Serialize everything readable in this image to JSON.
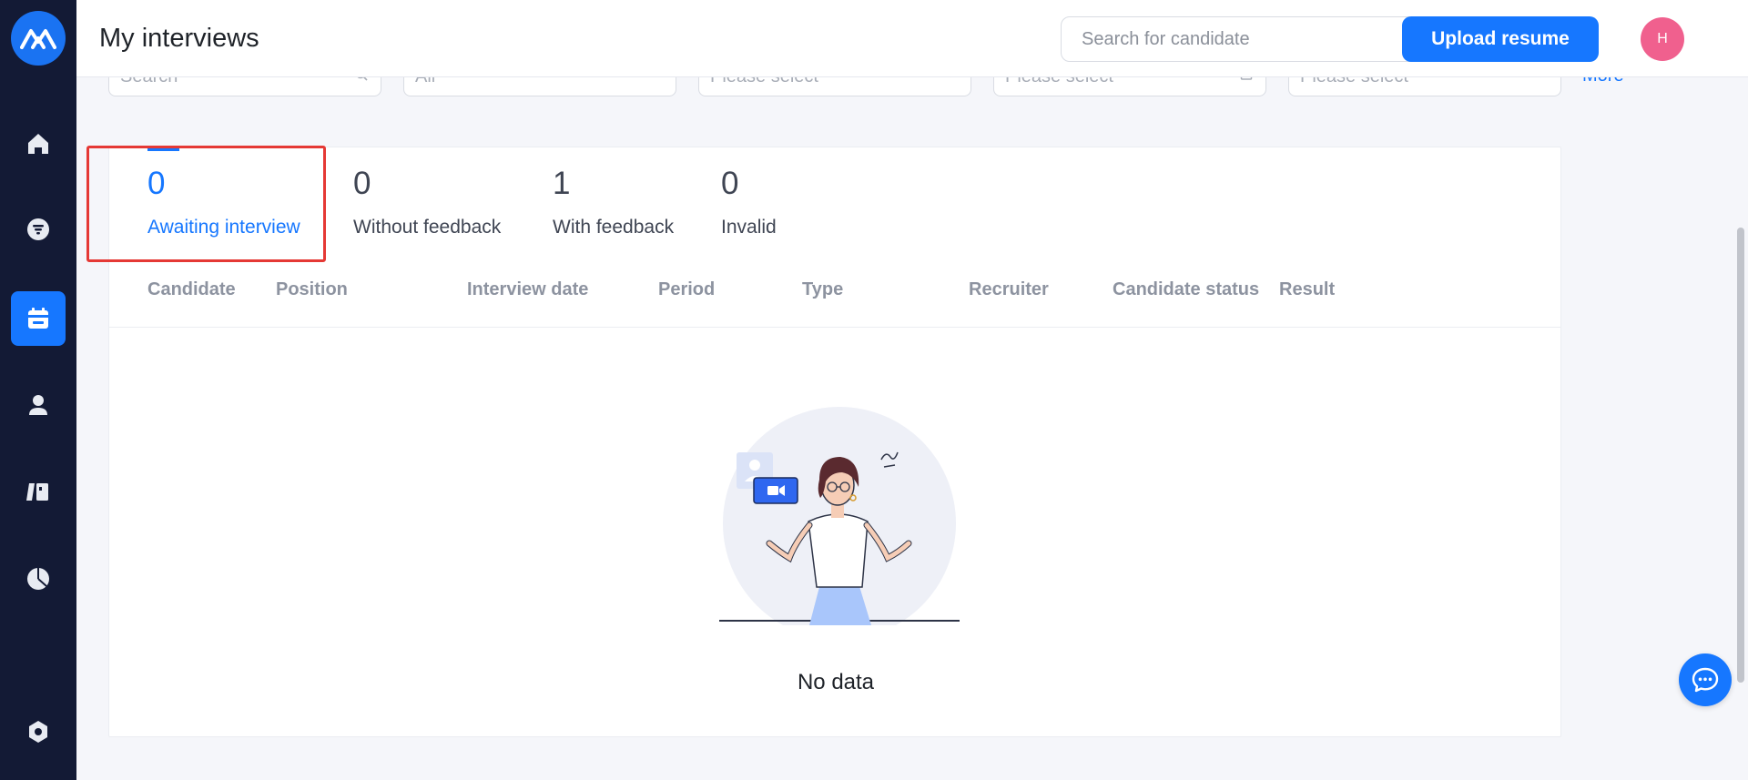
{
  "app": {
    "page_title": "My interviews",
    "search_placeholder": "Search for candidate",
    "upload_label": "Upload resume",
    "avatar_initial": "H",
    "accent_color": "#1677ff",
    "sidebar_bg": "#131a35"
  },
  "sidebar": {
    "items": [
      {
        "name": "home-icon"
      },
      {
        "name": "filter-icon"
      },
      {
        "name": "calendar-icon",
        "active": true
      },
      {
        "name": "user-icon"
      },
      {
        "name": "library-icon"
      },
      {
        "name": "pie-chart-icon"
      },
      {
        "name": "settings-icon"
      }
    ]
  },
  "filters": {
    "search_placeholder": "Search",
    "field1": "All",
    "field2": "Please select",
    "field3": "Please select",
    "field4": "Please select",
    "more": "More"
  },
  "tabs": [
    {
      "count": "0",
      "label": "Awaiting interview",
      "active": true
    },
    {
      "count": "0",
      "label": "Without feedback"
    },
    {
      "count": "1",
      "label": "With feedback"
    },
    {
      "count": "0",
      "label": "Invalid"
    }
  ],
  "table": {
    "columns": [
      "Candidate",
      "Position",
      "Interview date",
      "Period",
      "Type",
      "Recruiter",
      "Candidate status",
      "Result"
    ]
  },
  "empty": {
    "text": "No data"
  }
}
